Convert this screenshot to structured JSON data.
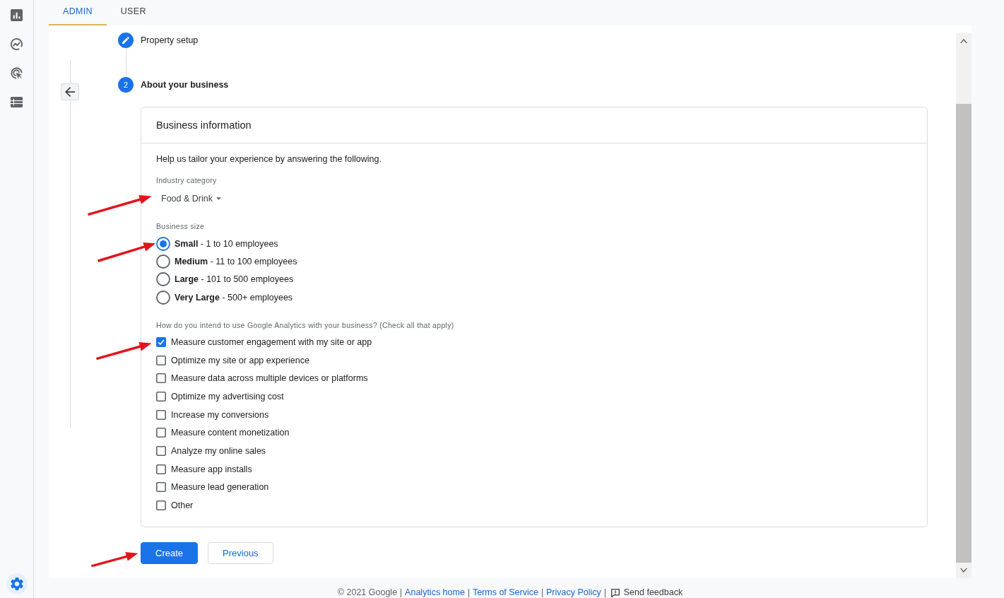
{
  "rail": {
    "admin_selected": true
  },
  "tabs": [
    {
      "label": "ADMIN",
      "selected": true
    },
    {
      "label": "USER",
      "selected": false
    }
  ],
  "steps": [
    {
      "label": "Property setup",
      "current": false
    },
    {
      "label": "About your business",
      "current": true,
      "number": "2"
    }
  ],
  "business_card": {
    "title": "Business information",
    "intro": "Help us tailor your experience by answering the following.",
    "industry": {
      "label": "Industry category",
      "value": "Food & Drink",
      "annotated": true
    },
    "business_size": {
      "label": "Business size",
      "options": [
        {
          "label": "**Small** - 1 to 10 employees",
          "selected": true,
          "annotated": true
        },
        {
          "label": "**Medium** - 11 to 100 employees",
          "selected": false,
          "annotated": false
        },
        {
          "label": "**Large** - 101 to 500 employees",
          "selected": false,
          "annotated": false
        },
        {
          "label": "**Very Large** - 500+ employees",
          "selected": false,
          "annotated": false
        }
      ]
    },
    "usage": {
      "label": "How do you intend to use Google Analytics with your business? (Check all that apply)",
      "options": [
        {
          "label": "Measure customer engagement with my site or app",
          "checked": true,
          "annotated": true
        },
        {
          "label": "Optimize my site or app experience",
          "checked": false,
          "annotated": false
        },
        {
          "label": "Measure data across multiple devices or platforms",
          "checked": false,
          "annotated": false
        },
        {
          "label": "Optimize my advertising cost",
          "checked": false,
          "annotated": false
        },
        {
          "label": "Increase my conversions",
          "checked": false,
          "annotated": false
        },
        {
          "label": "Measure content monetization",
          "checked": false,
          "annotated": false
        },
        {
          "label": "Analyze my online sales",
          "checked": false,
          "annotated": false
        },
        {
          "label": "Measure app installs",
          "checked": false,
          "annotated": false
        },
        {
          "label": "Measure lead generation",
          "checked": false,
          "annotated": false
        },
        {
          "label": "Other",
          "checked": false,
          "annotated": false
        }
      ]
    }
  },
  "buttons": [
    {
      "kind": "primary",
      "label": "Create",
      "annotated": true
    },
    {
      "kind": "secondary",
      "label": "Previous",
      "annotated": false
    }
  ],
  "footer": {
    "copyright": "© 2021 Google",
    "links": [
      "Analytics home",
      "Terms of Service",
      "Privacy Policy"
    ],
    "feedback": "Send feedback"
  }
}
